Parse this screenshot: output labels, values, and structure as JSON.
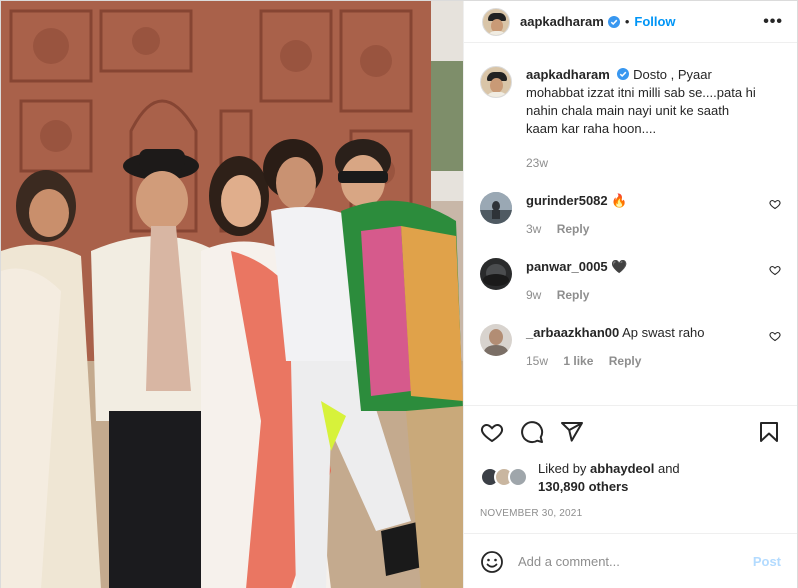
{
  "post": {
    "username": "aapkadharam",
    "follow_label": "Follow",
    "dot": "•",
    "more_label": "•••",
    "photo_alt": "Group photo in front of carved stone wall",
    "caption": {
      "username": "aapkadharam",
      "text": "Dosto , Pyaar mohabbat izzat itni milli sab se....pata hi nahin chala main nayi unit ke saath kaam kar raha hoon....",
      "time": "23w"
    },
    "comments": [
      {
        "username": "gurinder5082",
        "text": "🔥",
        "time": "3w",
        "likes": "",
        "reply": "Reply",
        "avatar_color": "#6b7a88"
      },
      {
        "username": "panwar_0005",
        "text": "🖤",
        "time": "9w",
        "likes": "",
        "reply": "Reply",
        "avatar_color": "#3a3a3a"
      },
      {
        "username": "_arbaazkhan00",
        "text": "Ap swast raho",
        "time": "15w",
        "likes": "1 like",
        "reply": "Reply",
        "avatar_color": "#b9b0a8"
      }
    ],
    "likes": {
      "prefix": "Liked by",
      "user": "abhaydeol",
      "connector": "and",
      "others": "130,890 others"
    },
    "date": "NOVEMBER 30, 2021",
    "composer": {
      "placeholder": "Add a comment...",
      "post_label": "Post"
    },
    "colors": {
      "accent": "#0095f6",
      "verified": "#3897f0",
      "muted": "#8e8e8e",
      "post_disabled": "#b3dbff"
    }
  }
}
